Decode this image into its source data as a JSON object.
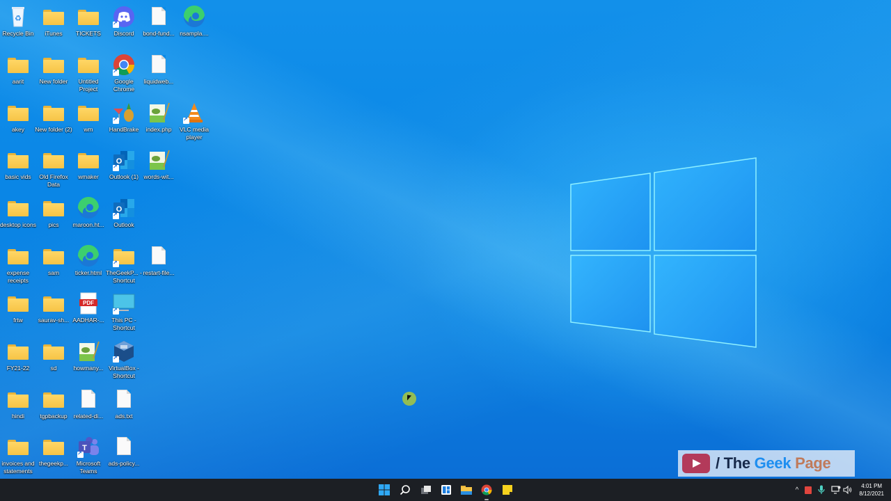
{
  "desktop": {
    "icons": [
      {
        "label": "Recycle Bin",
        "type": "recycle-bin"
      },
      {
        "label": "iTunes",
        "type": "folder"
      },
      {
        "label": "TICKETS",
        "type": "folder"
      },
      {
        "label": "Discord",
        "type": "discord",
        "shortcut": true
      },
      {
        "label": "bond-fund...",
        "type": "document"
      },
      {
        "label": "nsampla....",
        "type": "edge"
      },
      {
        "label": "aarit",
        "type": "folder"
      },
      {
        "label": "New folder",
        "type": "folder"
      },
      {
        "label": "Untitled Project",
        "type": "folder"
      },
      {
        "label": "Google Chrome",
        "type": "chrome",
        "shortcut": true
      },
      {
        "label": "liquidweb...",
        "type": "document"
      },
      {
        "label": "akey",
        "type": "folder"
      },
      {
        "label": "New folder (2)",
        "type": "folder"
      },
      {
        "label": "wm",
        "type": "folder"
      },
      {
        "label": "HandBrake",
        "type": "handbrake",
        "shortcut": true
      },
      {
        "label": "index.php",
        "type": "notepadpp"
      },
      {
        "label": "VLC media player",
        "type": "vlc",
        "shortcut": true
      },
      {
        "label": "basic vids",
        "type": "folder"
      },
      {
        "label": "Old Firefox Data",
        "type": "folder"
      },
      {
        "label": "wmaker",
        "type": "folder"
      },
      {
        "label": "Outlook (1)",
        "type": "outlook",
        "shortcut": true
      },
      {
        "label": "words-wit...",
        "type": "notepadpp"
      },
      {
        "label": "desktop icons",
        "type": "folder"
      },
      {
        "label": "pics",
        "type": "folder"
      },
      {
        "label": "maroon.ht...",
        "type": "edge"
      },
      {
        "label": "Outlook",
        "type": "outlook",
        "shortcut": true
      },
      {
        "label": "expense receipts",
        "type": "folder"
      },
      {
        "label": "sam",
        "type": "folder"
      },
      {
        "label": "ticker.html",
        "type": "edge"
      },
      {
        "label": "TheGeekP... - Shortcut",
        "type": "folder",
        "shortcut": true
      },
      {
        "label": "restart-file...",
        "type": "document"
      },
      {
        "label": "frtw",
        "type": "folder"
      },
      {
        "label": "saurav-sh...",
        "type": "folder"
      },
      {
        "label": "AADHAR-...",
        "type": "pdf"
      },
      {
        "label": "This PC - Shortcut",
        "type": "this-pc",
        "shortcut": true
      },
      {
        "label": "FY21-22",
        "type": "folder"
      },
      {
        "label": "sd",
        "type": "folder"
      },
      {
        "label": "howmany...",
        "type": "notepadpp"
      },
      {
        "label": "VirtualBox - Shortcut",
        "type": "virtualbox",
        "shortcut": true
      },
      {
        "label": "hindi",
        "type": "folder"
      },
      {
        "label": "tgpbackup",
        "type": "folder"
      },
      {
        "label": "related-di...",
        "type": "document"
      },
      {
        "label": "ads.txt",
        "type": "document"
      },
      {
        "label": "invoices and statements",
        "type": "folder"
      },
      {
        "label": "thegeekp...",
        "type": "folder"
      },
      {
        "label": "Microsoft Teams",
        "type": "teams",
        "shortcut": true
      },
      {
        "label": "ads-policy...",
        "type": "document"
      }
    ]
  },
  "taskbar": {
    "pinned": [
      {
        "name": "start",
        "icon": "windows-start-icon"
      },
      {
        "name": "search",
        "icon": "search-icon"
      },
      {
        "name": "task-view",
        "icon": "task-view-icon"
      },
      {
        "name": "widgets",
        "icon": "widgets-icon"
      },
      {
        "name": "file-explorer",
        "icon": "folder-icon"
      },
      {
        "name": "chrome",
        "icon": "chrome-icon",
        "active": true
      },
      {
        "name": "sticky-notes",
        "icon": "sticky-notes-icon"
      }
    ],
    "tray": {
      "overflow_glyph": "^",
      "clock_time": "4:01 PM",
      "clock_date": "8/12/2021"
    }
  },
  "watermark": {
    "slash": "/",
    "the": "The",
    "geek": "Geek",
    "page": "Page"
  },
  "colors": {
    "taskbar_bg": "#1c1f24",
    "wallpaper_blue": "#0a86e6",
    "folder_yellow": "#f6c446",
    "watermark_red": "#b33a5a"
  }
}
